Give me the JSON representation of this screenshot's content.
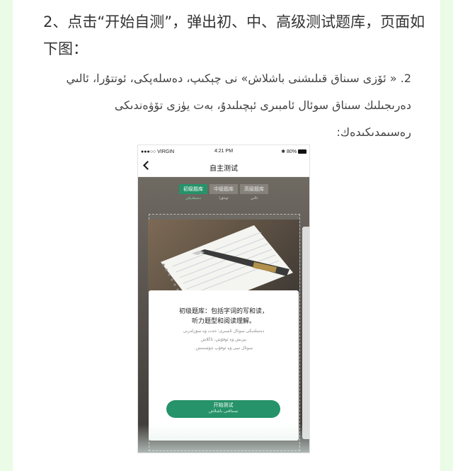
{
  "article": {
    "step2_cn": "2、点击“开始自测”，弹出初、中、高级测试题库，页面如下图：",
    "step2_ug": "2. « ئۆزى سىناق قىلىشنى باشلاش» نى چېكىپ، دەسلەپكى، ئوتتۇرا، ئالىي دەرىجىلىك سىناق سوئال ئامبىرى ئېچىلىدۇ، بەت يۈزى تۆۋەندىكى رەسىمدىكىدەك:"
  },
  "phone": {
    "status": {
      "carrier": "●●●○○ VIRGIN",
      "time": "4:21 PM",
      "battery": "80%"
    },
    "nav": {
      "title": "自主测试"
    },
    "tabs": [
      {
        "label": "初级题库",
        "sub": "دەسلەپكى",
        "active": true
      },
      {
        "label": "中级题库",
        "sub": "ئوتتۇرا",
        "active": false
      },
      {
        "label": "高级题库",
        "sub": "ئالىي",
        "active": false
      }
    ],
    "card": {
      "title_line1": "初级题库：包括字词的写和读，",
      "title_line2": "听力题型和阅读理解。",
      "ug_line1": "دەسلەپكى سوئال ئامبىرى: خەت ۋە سۆزلەرنى",
      "ug_line2": "يېزىش ۋە ئوقۇش، ئاڭلاش",
      "ug_line3": "سوئال تىپى ۋە ئوقۇپ چۈشىنىش.",
      "start_cn": "开始测试",
      "start_ug": "سىناقنى باشلاش"
    }
  }
}
